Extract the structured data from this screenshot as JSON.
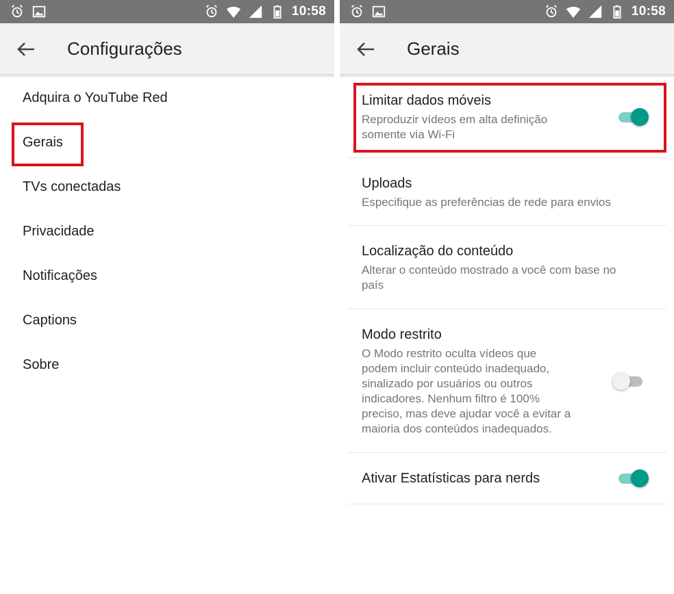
{
  "status_bar": {
    "time": "10:58",
    "icons_left": [
      "alarm-icon",
      "image-icon"
    ],
    "icons_right": [
      "alarm-icon",
      "wifi-icon",
      "battery-icon"
    ]
  },
  "left_screen": {
    "title": "Configurações",
    "items": [
      {
        "label": "Adquira o YouTube Red"
      },
      {
        "label": "Gerais",
        "highlighted": true
      },
      {
        "label": "TVs conectadas"
      },
      {
        "label": "Privacidade"
      },
      {
        "label": "Notificações"
      },
      {
        "label": "Captions"
      },
      {
        "label": "Sobre"
      }
    ]
  },
  "right_screen": {
    "title": "Gerais",
    "settings": [
      {
        "title": "Limitar dados móveis",
        "description": [
          "Reproduzir vídeos em alta definição",
          "somente via Wi-Fi"
        ],
        "toggle": "on",
        "highlighted": true
      },
      {
        "title": "Uploads",
        "description": [
          "Especifique as preferências de rede para envios"
        ]
      },
      {
        "title": "Localização do conteúdo",
        "description": [
          "Alterar o conteúdo mostrado a você com base no",
          "país"
        ]
      },
      {
        "title": "Modo restrito",
        "description": [
          "O Modo restrito oculta vídeos que",
          "podem incluir conteúdo inadequado,",
          "sinalizado por usuários ou outros",
          "indicadores. Nenhum filtro é 100%",
          "preciso, mas deve ajudar você a evitar a",
          "maioria dos conteúdos inadequados."
        ],
        "toggle": "off"
      },
      {
        "title": "Ativar Estatísticas para nerds",
        "toggle": "on"
      }
    ]
  },
  "colors": {
    "status_bar": "#757575",
    "app_bar": "#f2f2f2",
    "highlight": "#d9141e",
    "toggle_on": "#009a86",
    "toggle_on_track": "#7fd0c4"
  }
}
